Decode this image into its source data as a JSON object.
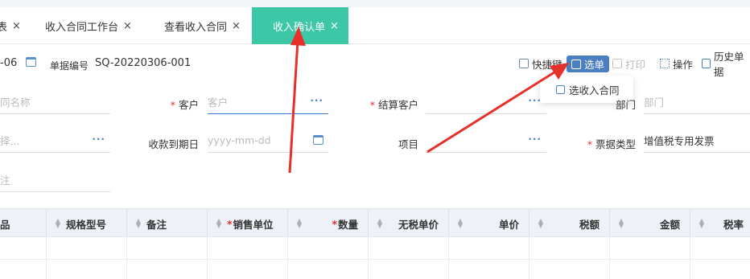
{
  "tabs": [
    {
      "label": "表",
      "close": "×"
    },
    {
      "label": "收入合同工作台",
      "close": "×"
    },
    {
      "label": "查看收入合同",
      "close": "×"
    },
    {
      "label": "收入确认单",
      "close": "×"
    }
  ],
  "toolbar": {
    "date_fragment": "-06",
    "doc_no_label": "单据编号",
    "doc_no_value": "SQ-20220306-001",
    "shortcut_label": "快捷键",
    "select_label": "选单",
    "print_label": "打印",
    "operate_label": "操作",
    "history_label": "历史单据"
  },
  "dropdown": {
    "item": "选收入合同"
  },
  "form": {
    "contract_name_placeholder": "同名称",
    "customer_label": "客户",
    "customer_placeholder": "客户",
    "settle_customer_label": "结算客户",
    "dept_label": "部门",
    "dept_placeholder": "部门",
    "select_placeholder": "择...",
    "due_date_label": "收款到期日",
    "due_date_placeholder": "yyyy-mm-dd",
    "project_label": "项目",
    "invoice_type_label": "票据类型",
    "invoice_type_value": "增值税专用发票",
    "remark_placeholder": "注",
    "dots": "···"
  },
  "grid": {
    "columns": [
      "品",
      "规格型号",
      "备注",
      "销售单位",
      "数量",
      "无税单价",
      "单价",
      "税额",
      "金额",
      "税率"
    ],
    "required_mark": "*"
  },
  "colors": {
    "accent_tab": "#3cc7a6",
    "select_button": "#4a7fc1",
    "annotation_arrow": "#e8302a"
  }
}
